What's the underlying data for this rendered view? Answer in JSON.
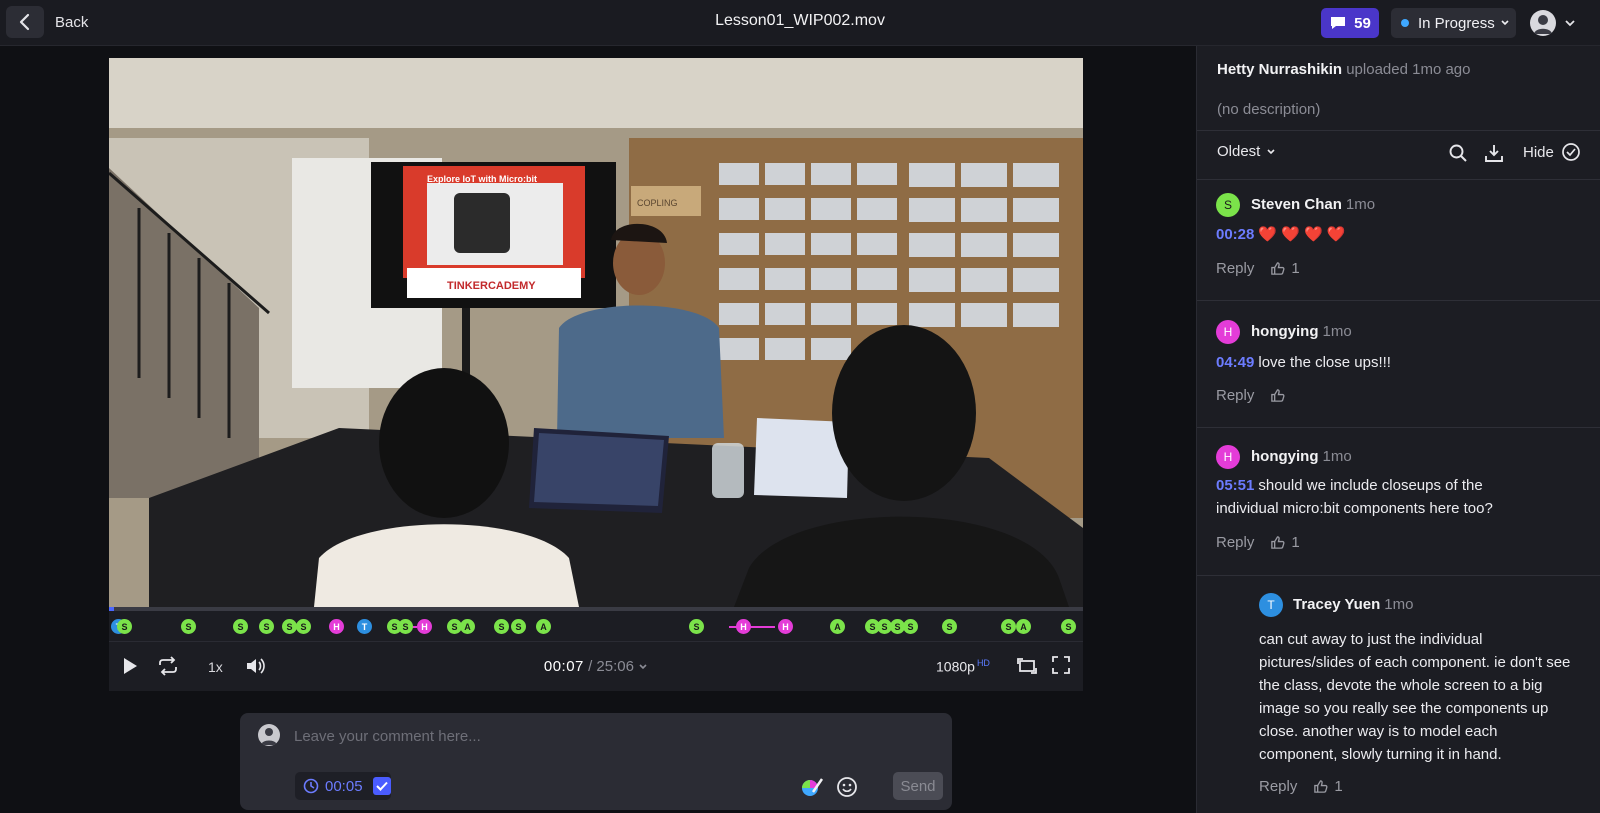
{
  "topbar": {
    "back_label": "Back",
    "title": "Lesson01_WIP002.mov",
    "comment_count": "59",
    "status": "In Progress"
  },
  "video": {
    "slide_title": "Explore IoT with Micro:bit",
    "slide_brand": "TINKERCADEMY",
    "box_label": "COPLING",
    "progress_fraction": 0.005
  },
  "timeline_markers": [
    {
      "letter": "T",
      "kind": "t",
      "pos": 0.009
    },
    {
      "letter": "S",
      "kind": "s",
      "pos": 0.015
    },
    {
      "letter": "S",
      "kind": "s",
      "pos": 0.081
    },
    {
      "letter": "S",
      "kind": "s",
      "pos": 0.134
    },
    {
      "letter": "S",
      "kind": "s",
      "pos": 0.161
    },
    {
      "letter": "S",
      "kind": "s",
      "pos": 0.185
    },
    {
      "letter": "S",
      "kind": "s",
      "pos": 0.199
    },
    {
      "letter": "H",
      "kind": "h",
      "pos": 0.233
    },
    {
      "letter": "T",
      "kind": "t",
      "pos": 0.262
    },
    {
      "letter": "S",
      "kind": "s",
      "pos": 0.293
    },
    {
      "letter": "S",
      "kind": "s",
      "pos": 0.304
    },
    {
      "letter": "H",
      "kind": "h",
      "pos": 0.323
    },
    {
      "letter": "S",
      "kind": "s",
      "pos": 0.354
    },
    {
      "letter": "A",
      "kind": "a",
      "pos": 0.368
    },
    {
      "letter": "S",
      "kind": "s",
      "pos": 0.402
    },
    {
      "letter": "S",
      "kind": "s",
      "pos": 0.42
    },
    {
      "letter": "A",
      "kind": "a",
      "pos": 0.446
    },
    {
      "letter": "S",
      "kind": "s",
      "pos": 0.603
    },
    {
      "letter": "H",
      "kind": "h",
      "pos": 0.651
    },
    {
      "letter": "H",
      "kind": "h",
      "pos": 0.694
    },
    {
      "letter": "A",
      "kind": "a",
      "pos": 0.747
    },
    {
      "letter": "S",
      "kind": "s",
      "pos": 0.783
    },
    {
      "letter": "S",
      "kind": "s",
      "pos": 0.796
    },
    {
      "letter": "S",
      "kind": "s",
      "pos": 0.809
    },
    {
      "letter": "S",
      "kind": "s",
      "pos": 0.822
    },
    {
      "letter": "S",
      "kind": "s",
      "pos": 0.862
    },
    {
      "letter": "S",
      "kind": "s",
      "pos": 0.923
    },
    {
      "letter": "A",
      "kind": "a",
      "pos": 0.938
    },
    {
      "letter": "S",
      "kind": "s",
      "pos": 0.985
    }
  ],
  "controls": {
    "speed": "1x",
    "current_time": "00:07",
    "separator": "/",
    "total_time": "25:06",
    "quality": "1080p",
    "hd": "HD"
  },
  "composer": {
    "placeholder": "Leave your comment here...",
    "timestamp": "00:05",
    "send_label": "Send"
  },
  "panel": {
    "uploader_name": "Hetty Nurrashikin",
    "uploader_meta": "uploaded 1mo ago",
    "description": "(no description)",
    "sort": "Oldest",
    "hide_label": "Hide",
    "reply_label": "Reply"
  },
  "comments": [
    {
      "initial": "S",
      "name": "Steven Chan",
      "time": "1mo",
      "timestamp": "00:28",
      "text": "❤️ ❤️ ❤️ ❤️",
      "likes": "1",
      "color": "#7be34a"
    },
    {
      "initial": "H",
      "name": "hongying",
      "time": "1mo",
      "timestamp": "04:49",
      "text": "love the close ups!!!",
      "likes": "",
      "color": "#e43cd8"
    },
    {
      "initial": "H",
      "name": "hongying",
      "time": "1mo",
      "timestamp": "05:51",
      "text": "should we include closeups of the individual micro:bit components here too?",
      "likes": "1",
      "color": "#e43cd8"
    },
    {
      "initial": "T",
      "name": "Tracey Yuen",
      "time": "1mo",
      "timestamp": "",
      "text": "can cut away to just the individual pictures/slides of each component. ie don't see the class, devote the whole screen to a big image so you really see the components up close. another way is to model each component, slowly turning it in hand.",
      "likes": "1",
      "color": "#2d8fe0"
    }
  ]
}
